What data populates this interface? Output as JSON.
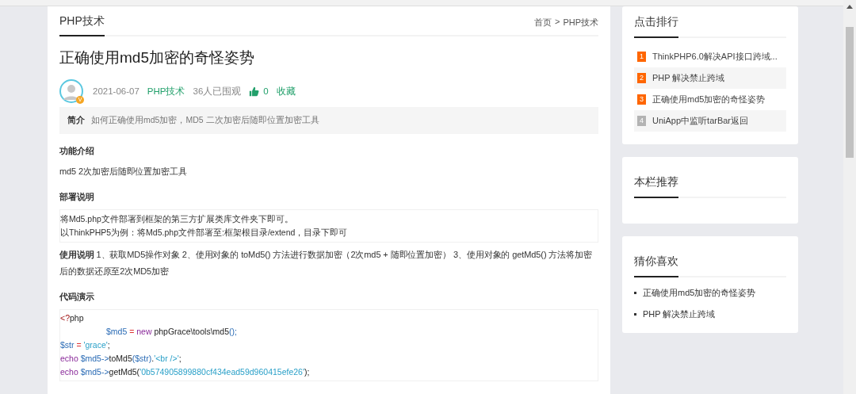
{
  "article": {
    "category_tab": "PHP技术",
    "breadcrumb": [
      {
        "label": "首页"
      },
      {
        "label": "PHP技术"
      }
    ],
    "breadcrumb_separator": ">",
    "title": "正确使用md5加密的奇怪姿势",
    "author_badge": "V",
    "date": "2021-06-07",
    "category": "PHP技术",
    "views": "36人已围观",
    "likes": "0",
    "favorite": "收藏",
    "summary": {
      "label": "简介",
      "text": "如何正确使用md5加密，MD5 二次加密后随即位置加密工具"
    },
    "blocks": [
      {
        "kind": "heading",
        "text": "功能介绍"
      },
      {
        "kind": "paragraph",
        "text": "md5 2次加密后随即位置加密工具"
      },
      {
        "kind": "heading",
        "text": "部署说明"
      },
      {
        "kind": "quote",
        "lines": [
          "将Md5.php文件部署到框架的第三方扩展类库文件夹下即可。",
          "以ThinkPHP5为例：将Md5.php文件部署至:框架根目录/extend，目录下即可"
        ]
      },
      {
        "kind": "paragraph",
        "text": "**使用说明** 1、获取MD5操作对象 2、使用对象的 toMd5() 方法进行数据加密（2次md5 + 随即位置加密） 3、使用对象的 getMd5() 方法将加密后的数据还原至2次MD5加密"
      },
      {
        "kind": "heading",
        "text": "代码演示"
      },
      {
        "kind": "code",
        "lines": [
          {
            "indent": false,
            "tokens": [
              {
                "kind": "tag",
                "text": "<?"
              },
              {
                "kind": "plain",
                "text": "php"
              }
            ]
          },
          {
            "indent": true,
            "tokens": [
              {
                "kind": "variable",
                "text": "$md5"
              },
              {
                "kind": "operator",
                "text": " = "
              },
              {
                "kind": "keyword",
                "text": "new"
              },
              {
                "kind": "plain",
                "text": " phpGrace\\tools\\md5"
              },
              {
                "kind": "variable",
                "text": "();"
              }
            ]
          },
          {
            "indent": false,
            "tokens": [
              {
                "kind": "variable",
                "text": "$str"
              },
              {
                "kind": "operator",
                "text": " = "
              },
              {
                "kind": "string",
                "text": "'grace'"
              },
              {
                "kind": "plain",
                "text": ";"
              }
            ]
          },
          {
            "indent": false,
            "tokens": [
              {
                "kind": "keyword",
                "text": "echo"
              },
              {
                "kind": "variable",
                "text": " $md5->"
              },
              {
                "kind": "plain",
                "text": "toMd5"
              },
              {
                "kind": "variable",
                "text": "($str)"
              },
              {
                "kind": "plain",
                "text": "."
              },
              {
                "kind": "string",
                "text": "'<br />'"
              },
              {
                "kind": "plain",
                "text": ";"
              }
            ]
          },
          {
            "indent": false,
            "tokens": [
              {
                "kind": "keyword",
                "text": "echo"
              },
              {
                "kind": "variable",
                "text": " $md5->"
              },
              {
                "kind": "plain",
                "text": "getMd5("
              },
              {
                "kind": "string",
                "text": "'0b574905899880cf434ead59d960415efe26'"
              },
              {
                "kind": "plain",
                "text": ");"
              }
            ]
          }
        ]
      }
    ]
  },
  "sidebar": [
    {
      "kind": "ranking",
      "title": "点击排行",
      "items": [
        {
          "rank": "1",
          "color": "#ff6600",
          "label": "ThinkPHP6.0解决API接口跨域..."
        },
        {
          "rank": "2",
          "color": "#ff6600",
          "label": "PHP 解决禁止跨域"
        },
        {
          "rank": "3",
          "color": "#ff6600",
          "label": "正确使用md5加密的奇怪姿势"
        },
        {
          "rank": "4",
          "color": "#b3b3b3",
          "label": "UniApp中监听tarBar返回"
        }
      ]
    },
    {
      "kind": "list",
      "title": "本栏推荐"
    },
    {
      "kind": "list",
      "title": "猜你喜欢",
      "items": [
        {
          "label": "正确使用md5加密的奇怪姿势"
        },
        {
          "label": "PHP 解决禁止跨域"
        }
      ]
    }
  ]
}
